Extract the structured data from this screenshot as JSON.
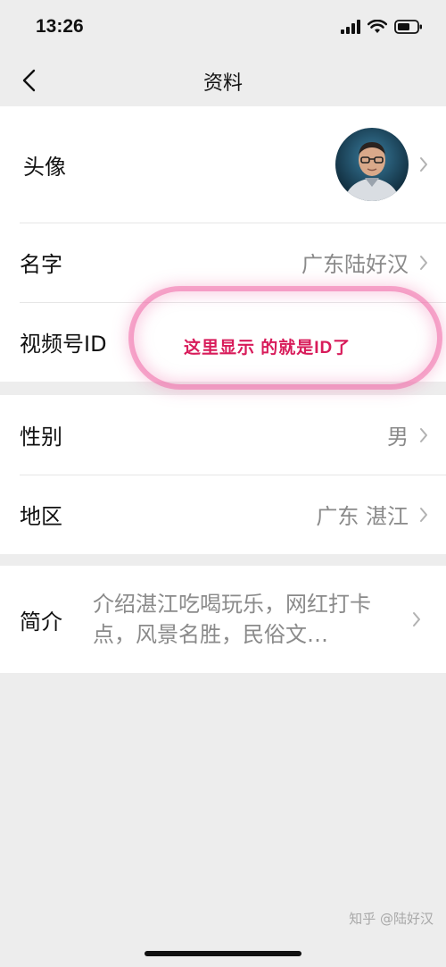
{
  "status_bar": {
    "time": "13:26",
    "icons": [
      "cellular-signal-icon",
      "wifi-icon",
      "battery-icon"
    ]
  },
  "nav": {
    "back_icon": "chevron-left-icon",
    "title": "资料"
  },
  "profile": {
    "avatar": {
      "label": "头像"
    },
    "name": {
      "label": "名字",
      "value": "广东陆好汉"
    },
    "video_id": {
      "label": "视频号ID",
      "value": ""
    },
    "gender": {
      "label": "性别",
      "value": "男"
    },
    "region": {
      "label": "地区",
      "value": "广东 湛江"
    },
    "intro": {
      "label": "简介",
      "value": "介绍湛江吃喝玩乐，网红打卡点，风景名胜，民俗文…"
    }
  },
  "annotation": {
    "text": "这里显示 的就是ID了",
    "color": "#d81b5a"
  },
  "watermark": "知乎 @陆好汉",
  "colors": {
    "background": "#ededed",
    "card": "#ffffff",
    "secondary_text": "#8a8a8a"
  }
}
